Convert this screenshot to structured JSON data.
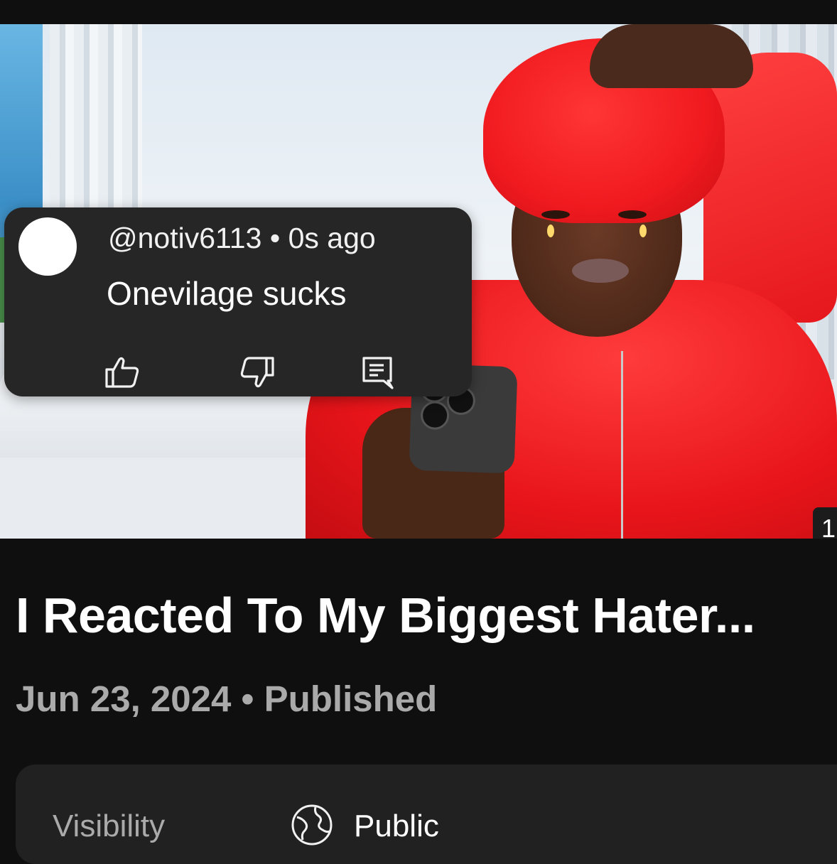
{
  "thumbnail": {
    "comment": {
      "handle": "@notiv6113",
      "separator": "•",
      "time": "0s ago",
      "text": "Onevilage sucks",
      "actions": [
        "like-icon",
        "dislike-icon",
        "reply-icon"
      ]
    },
    "duration_badge": "1"
  },
  "video": {
    "title": "I Reacted To My Biggest Hater...",
    "date": "Jun 23, 2024",
    "separator": "•",
    "status": "Published"
  },
  "visibility": {
    "label": "Visibility",
    "value": "Public",
    "icon": "globe-icon"
  },
  "colors": {
    "background": "#0f0f0f",
    "card": "#212121",
    "comment_card": "#262626",
    "secondary_text": "#aaaaaa",
    "hoodie_red": "#e8151a"
  }
}
